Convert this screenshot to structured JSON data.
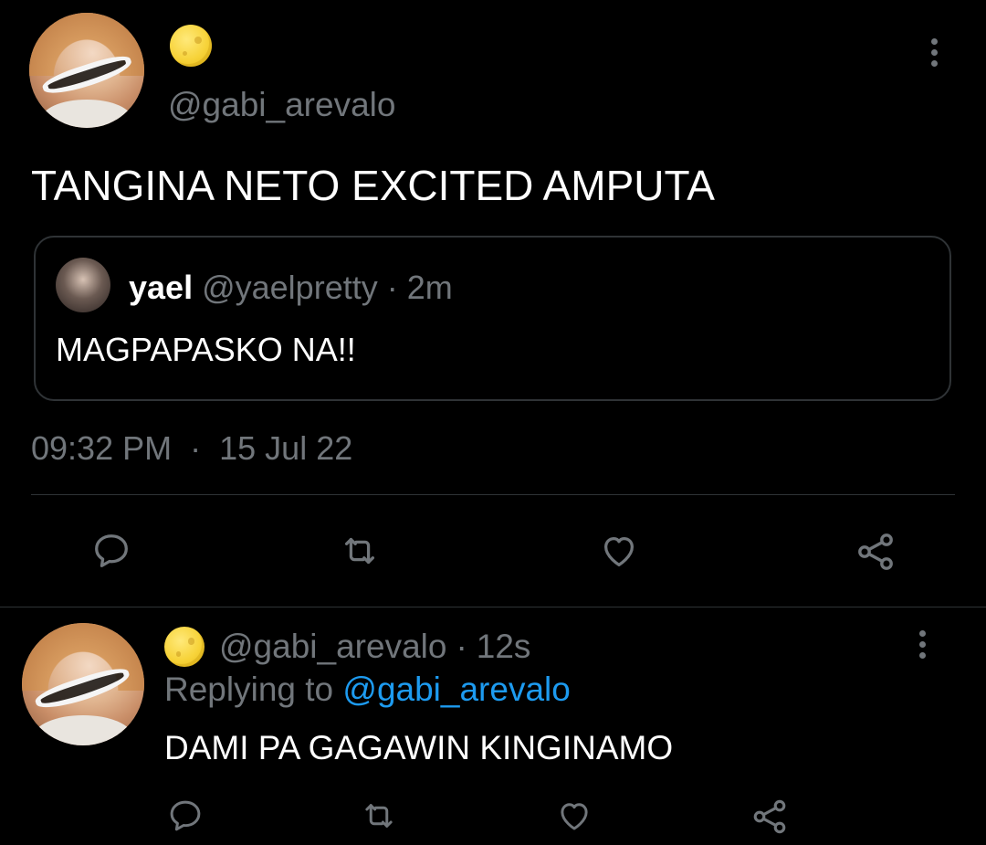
{
  "tweet": {
    "handle": "@gabi_arevalo",
    "text": "TANGINA NETO EXCITED AMPUTA",
    "quote": {
      "name": "yael",
      "handle": "@yaelpretty",
      "separator": "·",
      "time": "2m",
      "text": "MAGPAPASKO NA!!"
    },
    "time": "09:32 PM",
    "separator": "·",
    "date": "15 Jul 22",
    "actions": [
      "reply-icon",
      "retweet-icon",
      "like-icon",
      "share-icon"
    ]
  },
  "reply": {
    "handle": "@gabi_arevalo",
    "separator": "·",
    "time": "12s",
    "replying_prefix": "Replying to",
    "replying_handle": "@gabi_arevalo",
    "text": "DAMI PA GAGAWIN KINGINAMO",
    "actions": [
      "reply-icon",
      "retweet-icon",
      "like-icon",
      "share-icon"
    ]
  },
  "colors": {
    "background": "#000000",
    "text": "#e7e9ea",
    "muted": "#71767b",
    "link": "#1d9bf0",
    "divider": "#2f3336",
    "emoji": "#f7d33a"
  }
}
